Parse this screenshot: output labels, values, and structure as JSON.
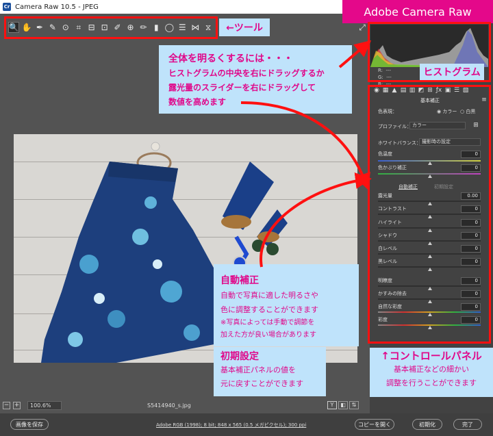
{
  "window": {
    "title": "Camera Raw 10.5  -  JPEG",
    "app_icon": "Cr"
  },
  "toolbar": {
    "tools": [
      {
        "name": "zoom-tool",
        "glyph": "🔍"
      },
      {
        "name": "hand-tool",
        "glyph": "✋"
      },
      {
        "name": "white-balance-tool",
        "glyph": "✒"
      },
      {
        "name": "color-sampler-tool",
        "glyph": "✎"
      },
      {
        "name": "targeted-adjustment-tool",
        "glyph": "⊙"
      },
      {
        "name": "crop-tool",
        "glyph": "⌗"
      },
      {
        "name": "straighten-tool",
        "glyph": "⊟"
      },
      {
        "name": "transform-tool",
        "glyph": "⊡"
      },
      {
        "name": "spot-removal-tool",
        "glyph": "✐"
      },
      {
        "name": "red-eye-tool",
        "glyph": "⊕"
      },
      {
        "name": "adjustment-brush-tool",
        "glyph": "✏"
      },
      {
        "name": "graduated-filter-tool",
        "glyph": "▮"
      },
      {
        "name": "radial-filter-tool",
        "glyph": "◯"
      },
      {
        "name": "preferences-tool",
        "glyph": "☰"
      },
      {
        "name": "rotate-ccw-tool",
        "glyph": "⋈"
      },
      {
        "name": "rotate-cw-tool",
        "glyph": "⧖"
      }
    ],
    "fullscreen_glyph": "⤢"
  },
  "histogram": {
    "r_label": "R:",
    "g_label": "G:",
    "b_label": "B:",
    "r_value": "---",
    "g_value": "---",
    "b_value": "---"
  },
  "panel": {
    "icons": [
      "◉",
      "▦",
      "▲",
      "▤",
      "▥",
      "◩",
      "⊞",
      "ƒx",
      "▣",
      "☰",
      "▧"
    ],
    "title": "基本補正",
    "menu_glyph": "≡",
    "treatment_label": "色表現：",
    "treatment_color": "カラー",
    "treatment_bw": "白黒",
    "profile_label": "プロファイル：",
    "profile_value": "カラー",
    "wb_label": "ホワイトバランス：",
    "wb_value": "撮影時の設定",
    "temp_label": "色温度",
    "temp_value": "0",
    "tint_label": "色かぶり補正",
    "tint_value": "0",
    "auto_label": "自動補正",
    "default_label": "初期設定",
    "exposure_label": "露光量",
    "exposure_value": "0.00",
    "contrast_label": "コントラスト",
    "contrast_value": "0",
    "highlights_label": "ハイライト",
    "highlights_value": "0",
    "shadows_label": "シャドウ",
    "shadows_value": "0",
    "whites_label": "白レベル",
    "whites_value": "0",
    "blacks_label": "黒レベル",
    "blacks_value": "0",
    "clarity_label": "明瞭度",
    "clarity_value": "0",
    "dehaze_label": "かすみの除去",
    "dehaze_value": "0",
    "vibrance_label": "自然な彩度",
    "vibrance_value": "0",
    "saturation_label": "彩度",
    "saturation_value": "0"
  },
  "status": {
    "zoom_value": "100.6%",
    "filename": "S5414940_s.jpg",
    "view_y_label": "Y"
  },
  "bottom": {
    "save_label": "画像を保存",
    "workflow_link": "Adobe RGB (1998); 8 bit; 848 x 565 (0.5 メガピクセル); 300 ppi",
    "open_copy_label": "コピーを開く",
    "reset_label": "初期化",
    "done_label": "完了"
  },
  "annotations": {
    "adobe_camera_raw": "Adobe Camera Raw",
    "tool_label": "←ツール",
    "histogram_label": "ヒストグラム",
    "brighten_title": "全体を明るくするには・・・",
    "brighten_line1": "ヒストグラムの中央を右にドラッグするか",
    "brighten_line2": "露光量のスライダーを右にドラッグして",
    "brighten_line3": "数値を高めます",
    "auto_title": "自動補正",
    "auto_line1": "自動で写真に適した明るさや",
    "auto_line2": "色に調整することができます",
    "auto_note1": "※写真によっては手動で調節を",
    "auto_note2": "加えた方が良い場合があります",
    "default_title": "初期設定",
    "default_line1": "基本補正パネルの値を",
    "default_line2": "元に戻すことができます",
    "control_title": "↑コントロールパネル",
    "control_line1": "基本補正などの細かい",
    "control_line2": "調整を行うことができます"
  }
}
